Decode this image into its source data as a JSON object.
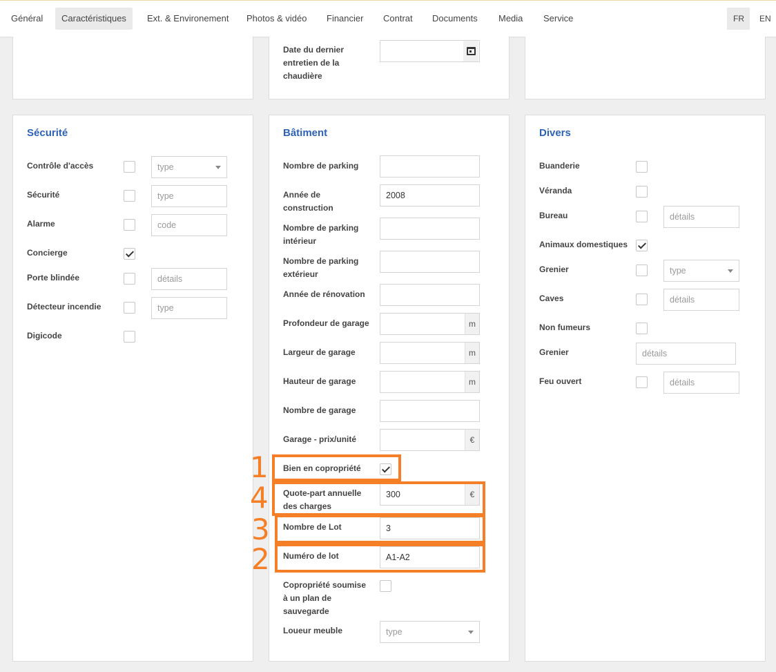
{
  "nav": {
    "tabs": [
      "Général",
      "Caractéristiques",
      "Ext. & Environement",
      "Photos & vidéo",
      "Financier",
      "Contrat",
      "Documents",
      "Media",
      "Service"
    ],
    "languages": [
      "FR",
      "EN"
    ]
  },
  "top_panel": {
    "boiler_label": "Date du dernier entretien de la chaudière",
    "boiler_icon": "calendar-icon"
  },
  "securite": {
    "title": "Sécurité",
    "rows": [
      {
        "label": "Contrôle d'accès",
        "checked": false,
        "field": "type",
        "field_kind": "select"
      },
      {
        "label": "Sécurité",
        "checked": false,
        "field": "type",
        "field_kind": "input"
      },
      {
        "label": "Alarme",
        "checked": false,
        "field": "code",
        "field_kind": "input"
      },
      {
        "label": "Concierge",
        "checked": true
      },
      {
        "label": "Porte blindée",
        "checked": false,
        "field": "détails",
        "field_kind": "input"
      },
      {
        "label": "Détecteur incendie",
        "checked": false,
        "field": "type",
        "field_kind": "input"
      },
      {
        "label": "Digicode",
        "checked": false
      }
    ]
  },
  "batiment": {
    "title": "Bâtiment",
    "nombre_parking": {
      "label": "Nombre de parking",
      "value": ""
    },
    "annee_construction": {
      "label": "Année de construction",
      "value": "2008"
    },
    "parking_interieur": {
      "label": "Nombre de parking intérieur",
      "value": ""
    },
    "parking_exterieur": {
      "label": "Nombre de parking extérieur",
      "value": ""
    },
    "annee_renovation": {
      "label": "Année de rénovation",
      "value": ""
    },
    "profondeur_garage": {
      "label": "Profondeur de garage",
      "value": "",
      "unit": "m"
    },
    "largeur_garage": {
      "label": "Largeur de garage",
      "value": "",
      "unit": "m"
    },
    "hauteur_garage": {
      "label": "Hauteur de garage",
      "value": "",
      "unit": "m"
    },
    "nombre_garage": {
      "label": "Nombre de garage",
      "value": ""
    },
    "garage_prix": {
      "label": "Garage - prix/unité",
      "value": "",
      "unit": "€"
    },
    "copropriete": {
      "label": "Bien en copropriété",
      "checked": true
    },
    "quote_part": {
      "label": "Quote-part annuelle des charges",
      "value": "300",
      "unit": "€"
    },
    "nombre_lot": {
      "label": "Nombre de Lot",
      "value": "3"
    },
    "numero_lot": {
      "label": "Numéro de lot",
      "value": "A1-A2"
    },
    "plan_sauvegarde": {
      "label": "Copropriété soumise à un plan de sauvegarde",
      "checked": false
    },
    "loueur_meuble": {
      "label": "Loueur meuble",
      "placeholder": "type"
    }
  },
  "divers": {
    "title": "Divers",
    "rows": [
      {
        "label": "Buanderie",
        "checked": false
      },
      {
        "label": "Véranda",
        "checked": false
      },
      {
        "label": "Bureau",
        "checked": false,
        "field": "détails"
      },
      {
        "label": "Animaux domestiques",
        "checked": true
      },
      {
        "label": "Grenier",
        "checked": false,
        "field": "type"
      },
      {
        "label": "Caves",
        "checked": false,
        "field": "détails"
      },
      {
        "label": "Non fumeurs",
        "checked": false
      },
      {
        "label": "Grenier",
        "field": "détails"
      },
      {
        "label": "Feu ouvert",
        "checked": false,
        "field": "détails"
      }
    ]
  },
  "annotations": [
    "1",
    "4",
    "3",
    "2"
  ],
  "colors": {
    "accent": "#2e62b5",
    "highlight": "#f47f27"
  }
}
